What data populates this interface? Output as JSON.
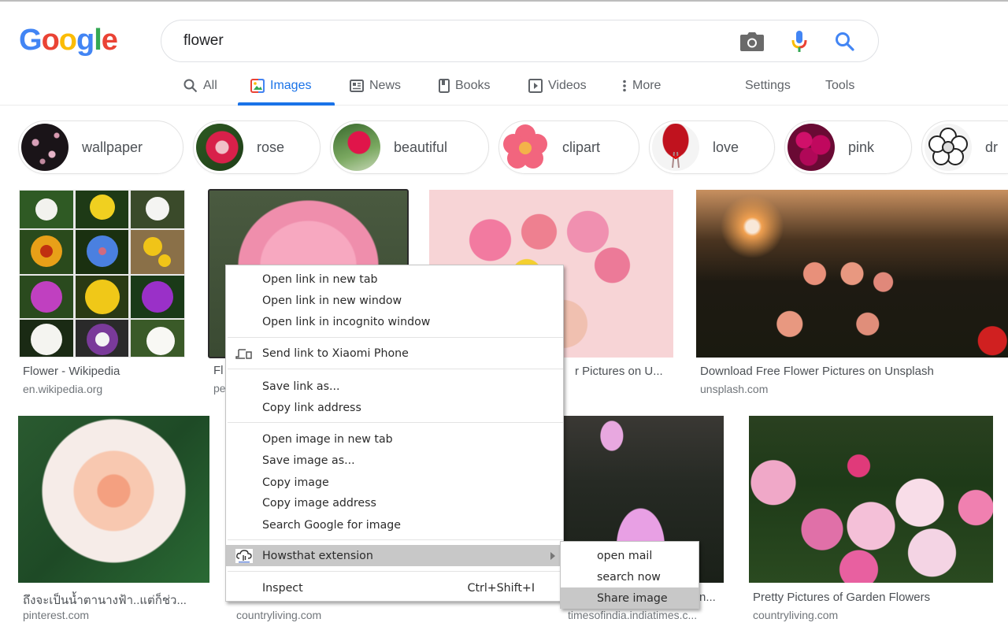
{
  "logo": {
    "letters": [
      "G",
      "o",
      "o",
      "g",
      "l",
      "e"
    ],
    "colors": [
      "#4285f4",
      "#ea4335",
      "#fbbc05",
      "#4285f4",
      "#34a853",
      "#ea4335"
    ]
  },
  "search": {
    "query": "flower",
    "placeholder": ""
  },
  "nav": {
    "tabs": [
      {
        "label": "All",
        "icon": "search-icon"
      },
      {
        "label": "Images",
        "icon": "image-icon",
        "active": true
      },
      {
        "label": "News",
        "icon": "news-icon"
      },
      {
        "label": "Books",
        "icon": "book-icon"
      },
      {
        "label": "Videos",
        "icon": "play-icon"
      },
      {
        "label": "More",
        "icon": "more-vert-icon"
      }
    ],
    "settings": "Settings",
    "tools": "Tools",
    "accent": "#1a73e8"
  },
  "chips": [
    {
      "label": "wallpaper"
    },
    {
      "label": "rose"
    },
    {
      "label": "beautiful"
    },
    {
      "label": "clipart"
    },
    {
      "label": "love"
    },
    {
      "label": "pink"
    },
    {
      "label": "dr"
    }
  ],
  "results": [
    {
      "title": "Flower - Wikipedia",
      "source": "en.wikipedia.org"
    },
    {
      "title": "Fl",
      "source": "pe"
    },
    {
      "title": "r Pictures on U...",
      "source": ""
    },
    {
      "title": "Download Free Flower Pictures on Unsplash",
      "source": "unsplash.com"
    },
    {
      "title": "ถึงจะเป็นน้ำตานางฟ้า..แต่ก็ช่ว...",
      "source": "pinterest.com"
    },
    {
      "title": "",
      "source": "countryliving.com"
    },
    {
      "title": "n...",
      "source": "timesofindia.indiatimes.c..."
    },
    {
      "title": "Pretty Pictures of Garden Flowers",
      "source": "countryliving.com"
    }
  ],
  "context_menu": {
    "items": [
      {
        "label": "Open link in new tab"
      },
      {
        "label": "Open link in new window"
      },
      {
        "label": "Open link in incognito window"
      },
      {
        "label": "Send link to Xiaomi Phone",
        "icon": "devices-icon"
      },
      {
        "label": "Save link as..."
      },
      {
        "label": "Copy link address"
      },
      {
        "label": "Open image in new tab"
      },
      {
        "label": "Save image as..."
      },
      {
        "label": "Copy image"
      },
      {
        "label": "Copy image address"
      },
      {
        "label": "Search Google for image"
      },
      {
        "label": "Howsthat extension",
        "icon": "cloud-extension-icon",
        "has_submenu": true,
        "highlighted": true
      },
      {
        "label": "Inspect",
        "shortcut": "Ctrl+Shift+I"
      }
    ]
  },
  "submenu": {
    "items": [
      {
        "label": "open mail"
      },
      {
        "label": "search now"
      },
      {
        "label": "Share image",
        "highlighted": true
      }
    ]
  }
}
